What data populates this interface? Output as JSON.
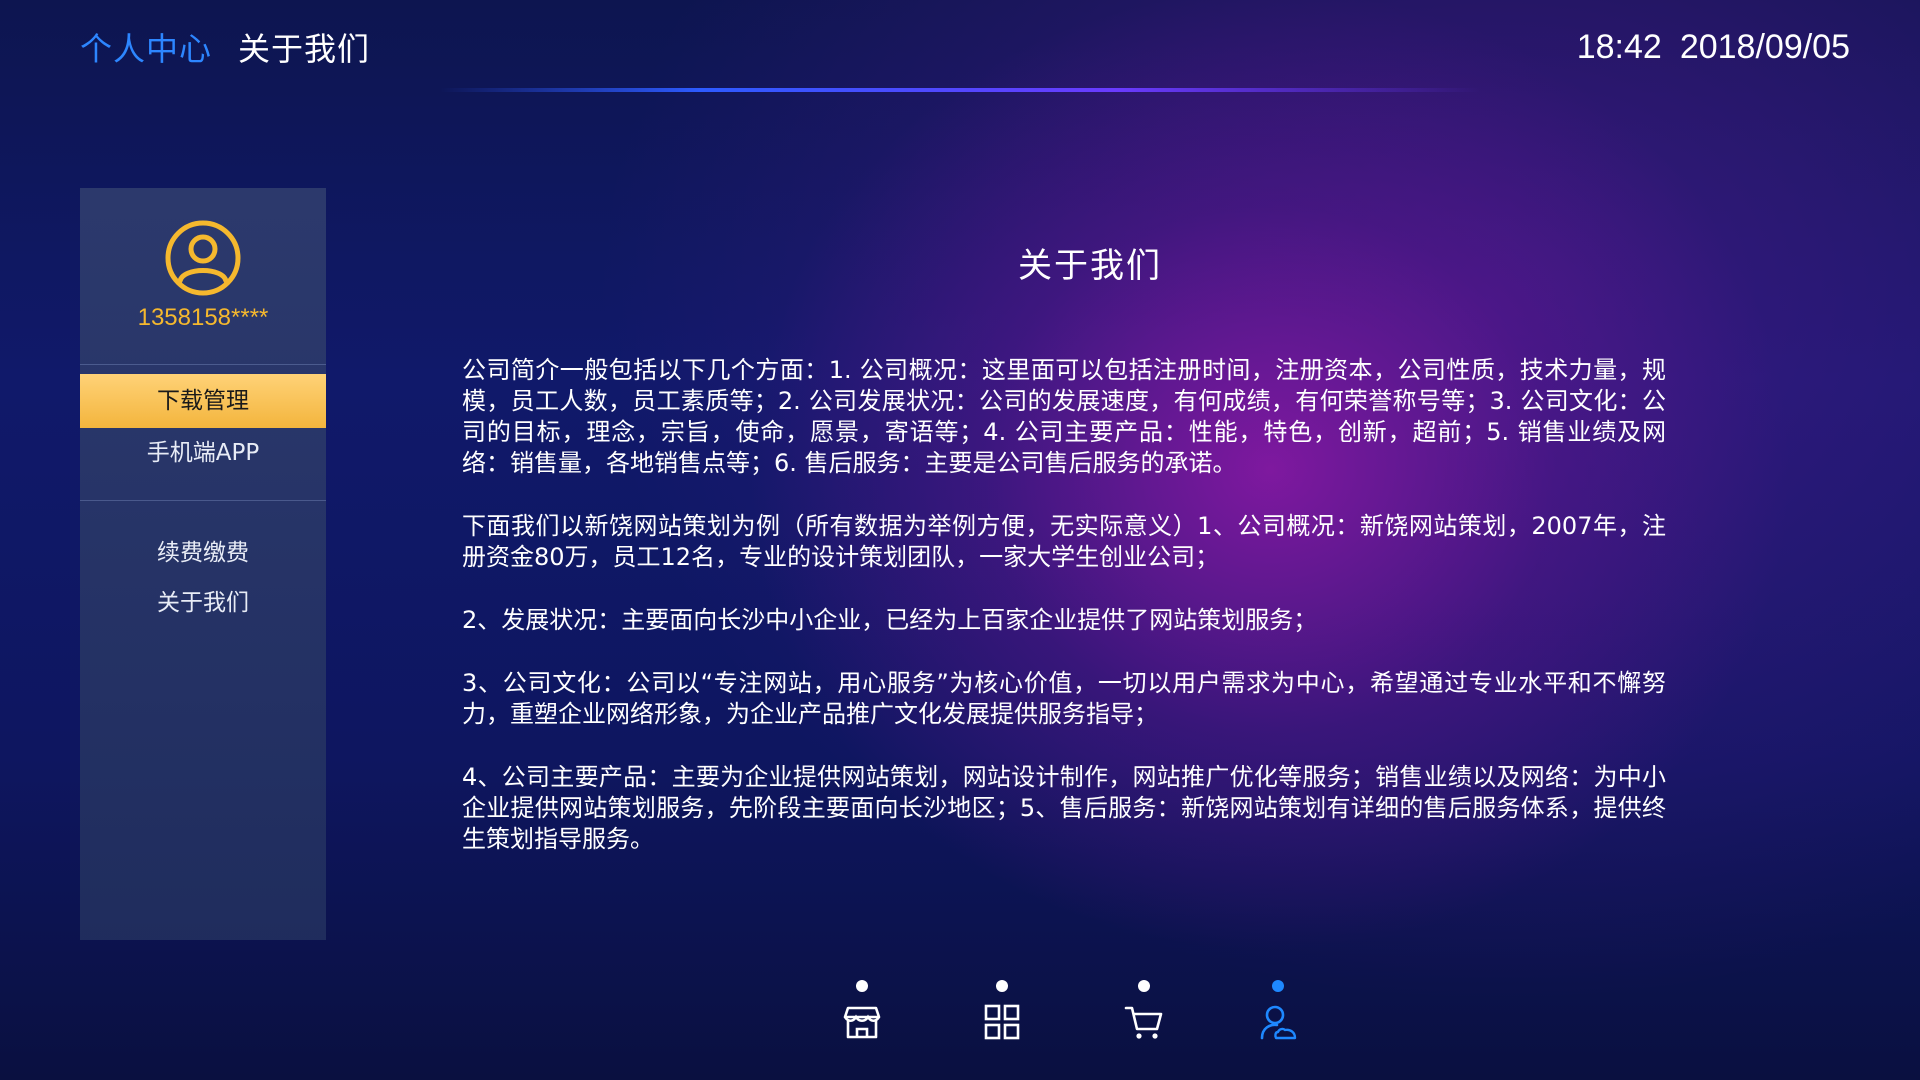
{
  "header": {
    "breadcrumb_root": "个人中心",
    "breadcrumb_current": "关于我们",
    "time": "18:42",
    "date": "2018/09/05"
  },
  "sidebar": {
    "phone": "1358158****",
    "items": [
      {
        "label": "下载管理",
        "active": true
      },
      {
        "label": "手机端APP",
        "active": false
      },
      {
        "label": "续费缴费",
        "active": false
      },
      {
        "label": "关于我们",
        "active": false
      }
    ]
  },
  "content": {
    "title": "关于我们",
    "paragraphs": [
      "公司简介一般包括以下几个方面：1. 公司概况：这里面可以包括注册时间，注册资本，公司性质，技术力量，规模，员工人数，员工素质等；2. 公司发展状况：公司的发展速度，有何成绩，有何荣誉称号等；3. 公司文化：公司的目标，理念，宗旨，使命，愿景，寄语等；4. 公司主要产品：性能，特色，创新，超前；5. 销售业绩及网络：销售量，各地销售点等；6. 售后服务：主要是公司售后服务的承诺。",
      "下面我们以新饶网站策划为例（所有数据为举例方便，无实际意义）1、公司概况：新饶网站策划，2007年，注册资金80万，员工12名，专业的设计策划团队，一家大学生创业公司；",
      "2、发展状况：主要面向长沙中小企业，已经为上百家企业提供了网站策划服务；",
      "3、公司文化：公司以“专注网站，用心服务”为核心价值，一切以用户需求为中心，希望通过专业水平和不懈努力，重塑企业网络形象，为企业产品推广文化发展提供服务指导；",
      "4、公司主要产品：主要为企业提供网站策划，网站设计制作，网站推广优化等服务；销售业绩以及网络：为中小企业提供网站策划服务，先阶段主要面向长沙地区；5、售后服务：新饶网站策划有详细的售后服务体系，提供终生策划指导服务。"
    ]
  },
  "bottom_nav": {
    "items": [
      {
        "icon": "store-icon",
        "active": false
      },
      {
        "icon": "grid-icon",
        "active": false
      },
      {
        "icon": "cart-icon",
        "active": false
      },
      {
        "icon": "user-icon",
        "active": true
      }
    ]
  },
  "colors": {
    "accent_blue": "#2d86ff",
    "highlight_gold": "#f5b82e",
    "active_item_bg": "#ffc857",
    "nav_active_dot": "#1e88ff"
  }
}
